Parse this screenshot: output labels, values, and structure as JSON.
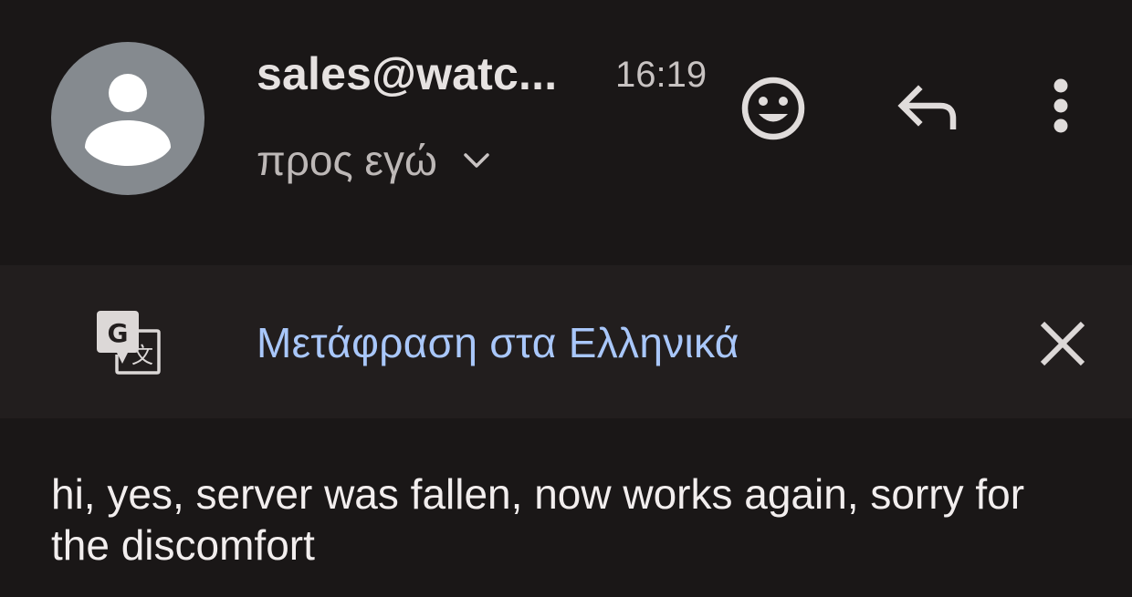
{
  "header": {
    "sender": "sales@watc...",
    "time": "16:19",
    "recipient": "προς εγώ",
    "avatar_icon": "person-icon",
    "actions": [
      {
        "name": "emoji-reaction",
        "icon": "smiley-icon"
      },
      {
        "name": "reply",
        "icon": "reply-icon"
      },
      {
        "name": "more-options",
        "icon": "more-vert-icon"
      }
    ]
  },
  "translate_bar": {
    "label": "Μετάφραση στα Ελληνικά",
    "icon": "google-translate-icon",
    "close_icon": "close-icon"
  },
  "message": {
    "body": "hi, yes, server was fallen, now works again, sorry for the discomfort"
  },
  "colors": {
    "background": "#1a1717",
    "banner_background": "#221e1e",
    "link_blue": "#a9c7fa",
    "avatar_gray": "#858a8f"
  }
}
